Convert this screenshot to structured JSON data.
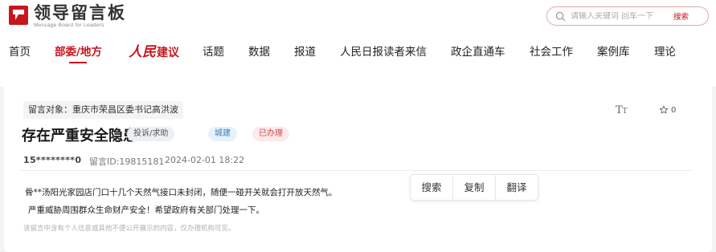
{
  "header": {
    "logo_title": "领导留言板",
    "logo_subtitle": "Message Board for Leaders",
    "search": {
      "placeholder": "请输入关键词 回车一下",
      "button_label": "搜索"
    }
  },
  "nav": {
    "items": [
      {
        "label": "首页"
      },
      {
        "label": "部委/地方"
      },
      {
        "label_script": "人民",
        "label_rest": "建议"
      },
      {
        "label": "话题"
      },
      {
        "label": "数据"
      },
      {
        "label": "报道"
      },
      {
        "label": "人民日报读者来信"
      },
      {
        "label": "政企直通车"
      },
      {
        "label": "社会工作"
      },
      {
        "label": "案例库"
      },
      {
        "label": "理论"
      }
    ],
    "active_index": 1
  },
  "message": {
    "target": "留言对象：重庆市荣昌区委书记高洪波",
    "font_size_icon_label": "T",
    "font_size_icon_label_small": "T",
    "favorite_count": "0",
    "title": "存在严重安全隐患",
    "tags": {
      "type": "投诉/求助",
      "domain": "城建",
      "status": "已办理"
    },
    "user": "15********0",
    "id_text": "留言ID:19815181",
    "time": "2024-02-01 18:22",
    "body_line1": "骨**汤阳光家园店门口十几个天然气接口未封闭，随便一碰开关就会打开放天然气。",
    "body_line2": "严重威胁周围群众生命财产安全！希望政府有关部门处理一下。",
    "notice": "该留言中含有个人信息或其他不便公开展示的内容，仅办理机构可见。"
  },
  "toolbar": {
    "search_label": "搜索",
    "copy_label": "复制",
    "translate_label": "翻译"
  },
  "colors": {
    "brand_red": "#c8161e",
    "status_red": "#d14848",
    "domain_blue": "#3e7fb6"
  },
  "icons": {
    "logo": "logo-mark-icon",
    "search": "search-icon",
    "font_size": "font-size-icon",
    "favorite": "star-icon"
  }
}
